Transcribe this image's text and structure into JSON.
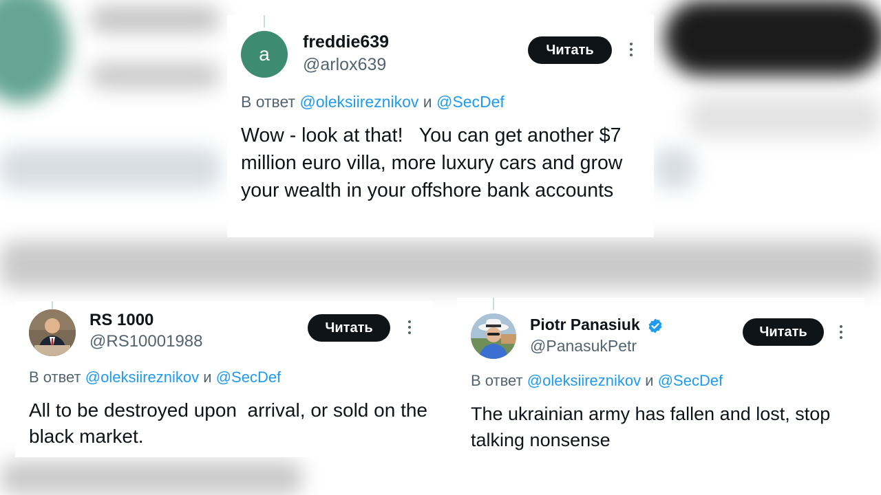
{
  "tweets": [
    {
      "avatar_letter": "a",
      "name": "freddie639",
      "handle": "@arlox639",
      "read_label": "Читать",
      "reply_prefix": "В ответ",
      "mention1": "@oleksiireznikov",
      "conj": "и",
      "mention2": "@SecDef",
      "text": "Wow - look at that!   You can get another $7 million euro villa, more luxury cars and grow your wealth in your offshore bank accounts"
    },
    {
      "name": "RS 1000",
      "handle": "@RS10001988",
      "read_label": "Читать",
      "reply_prefix": "В ответ",
      "mention1": "@oleksiireznikov",
      "conj": "и",
      "mention2": "@SecDef",
      "text": "All to be destroyed upon  arrival, or sold on the black market."
    },
    {
      "name": "Piotr Panasiuk",
      "handle": "@PanasukPetr",
      "read_label": "Читать",
      "reply_prefix": "В ответ",
      "mention1": "@oleksiireznikov",
      "conj": "и",
      "mention2": "@SecDef",
      "text": "The ukrainian army has fallen and lost, stop talking nonsense"
    }
  ],
  "colors": {
    "avatar_green": "#3d8c72",
    "mention_blue": "#1d9bf0",
    "button_dark": "#0f1419",
    "handle_gray": "#536471"
  }
}
